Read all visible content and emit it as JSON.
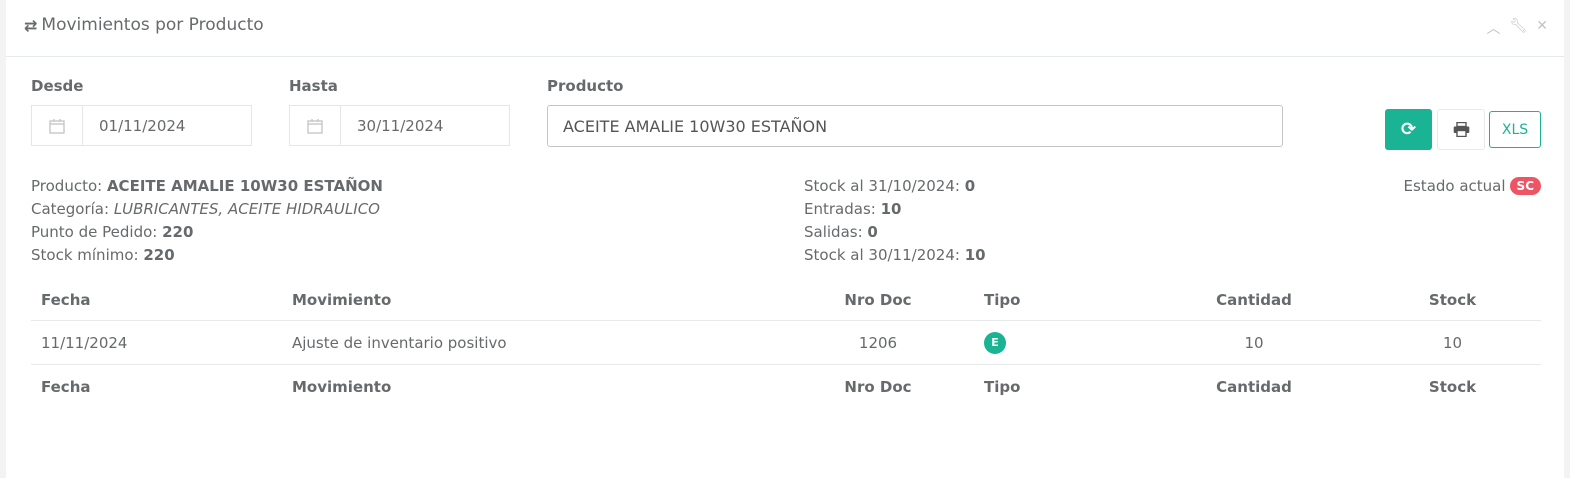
{
  "header": {
    "title": "Movimientos por Producto",
    "tools": [
      "chevron-up-icon",
      "wrench-icon",
      "close-icon"
    ]
  },
  "filters": {
    "desde_label": "Desde",
    "desde_value": "01/11/2024",
    "hasta_label": "Hasta",
    "hasta_value": "30/11/2024",
    "producto_label": "Producto",
    "producto_value": "ACEITE AMALIE  10W30 ESTAÑON",
    "xls_label": "XLS"
  },
  "info": {
    "producto_label": "Producto: ",
    "producto_value": "ACEITE AMALIE 10W30 ESTAÑON",
    "categoria_label": "Categoría: ",
    "categoria_value": "LUBRICANTES, ACEITE HIDRAULICO",
    "punto_label": "Punto de Pedido: ",
    "punto_value": "220",
    "minimo_label": "Stock mínimo: ",
    "minimo_value": "220",
    "stock_ini_label": "Stock al 31/10/2024: ",
    "stock_ini_value": "0",
    "entradas_label": "Entradas: ",
    "entradas_value": "10",
    "salidas_label": "Salidas: ",
    "salidas_value": "0",
    "stock_fin_label": "Stock al 30/11/2024: ",
    "stock_fin_value": "10",
    "estado_label": "Estado actual",
    "estado_badge": "SC"
  },
  "table": {
    "headers": [
      "Fecha",
      "Movimiento",
      "Nro Doc",
      "Tipo",
      "Cantidad",
      "Stock"
    ],
    "rows": [
      {
        "fecha": "11/11/2024",
        "movimiento": "Ajuste de inventario positivo",
        "nro_doc": "1206",
        "tipo": "E",
        "cantidad": "10",
        "stock": "10"
      }
    ]
  },
  "colors": {
    "accent": "#1ab394",
    "danger": "#ed5565",
    "text": "#676a6c"
  }
}
